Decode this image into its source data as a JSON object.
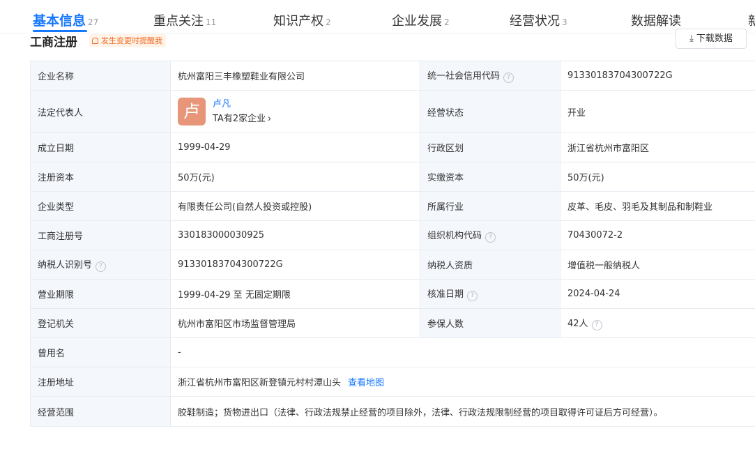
{
  "tabs": [
    {
      "label": "基本信息",
      "count": "27"
    },
    {
      "label": "重点关注",
      "count": "11"
    },
    {
      "label": "知识产权",
      "count": "2"
    },
    {
      "label": "企业发展",
      "count": "2"
    },
    {
      "label": "经营状况",
      "count": "3"
    },
    {
      "label": "数据解读",
      "count": ""
    },
    {
      "label": "新",
      "count": ""
    }
  ],
  "section": {
    "title": "工商注册",
    "remind_label": "发生变更时提醒我",
    "download_label": "下载数据"
  },
  "table": {
    "company_name": {
      "label": "企业名称",
      "value": "杭州富阳三丰橡塑鞋业有限公司"
    },
    "credit_code": {
      "label": "统一社会信用代码",
      "value": "91330183704300722G"
    },
    "legal_rep": {
      "label": "法定代表人",
      "avatar_char": "卢",
      "name": "卢凡",
      "sub": "TA有2家企业"
    },
    "status": {
      "label": "经营状态",
      "value": "开业"
    },
    "founded": {
      "label": "成立日期",
      "value": "1999-04-29"
    },
    "region": {
      "label": "行政区划",
      "value": "浙江省杭州市富阳区"
    },
    "reg_capital": {
      "label": "注册资本",
      "value": "50万(元)"
    },
    "paid_capital": {
      "label": "实缴资本",
      "value": "50万(元)"
    },
    "company_type": {
      "label": "企业类型",
      "value": "有限责任公司(自然人投资或控股)"
    },
    "industry": {
      "label": "所属行业",
      "value": "皮革、毛皮、羽毛及其制品和制鞋业"
    },
    "reg_no": {
      "label": "工商注册号",
      "value": "330183000030925"
    },
    "org_code": {
      "label": "组织机构代码",
      "value": "70430072-2"
    },
    "taxpayer_id": {
      "label": "纳税人识别号",
      "value": "91330183704300722G"
    },
    "taxpayer_qual": {
      "label": "纳税人资质",
      "value": "增值税一般纳税人"
    },
    "term": {
      "label": "营业期限",
      "value": "1999-04-29 至 无固定期限"
    },
    "approved": {
      "label": "核准日期",
      "value": "2024-04-24"
    },
    "authority": {
      "label": "登记机关",
      "value": "杭州市富阳区市场监督管理局"
    },
    "insured": {
      "label": "参保人数",
      "value": "42人"
    },
    "former_name": {
      "label": "曾用名",
      "value": "-"
    },
    "address": {
      "label": "注册地址",
      "value": "浙江省杭州市富阳区新登镇元村村潭山头",
      "link": "查看地图"
    },
    "scope": {
      "label": "经营范围",
      "value": "胶鞋制造；货物进出口（法律、行政法规禁止经营的项目除外，法律、行政法规限制经营的项目取得许可证后方可经营）。"
    }
  },
  "colors": {
    "accent": "#1677ff",
    "remind": "#f06f26",
    "label_bg": "#f4f7fc",
    "avatar": "#e8967a"
  }
}
